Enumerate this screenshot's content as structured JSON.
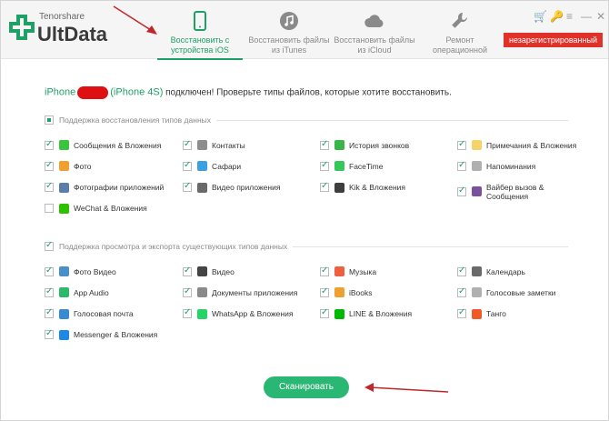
{
  "brand": {
    "small": "Tenorshare",
    "big": "UltData"
  },
  "tabs": [
    {
      "label1": "Восстановить с",
      "label2": "устройства iOS",
      "icon": "phone-icon",
      "active": true
    },
    {
      "label1": "Восстановить файлы",
      "label2": "из iTunes",
      "icon": "music-icon",
      "active": false
    },
    {
      "label1": "Восстановить файлы",
      "label2": "из iCloud",
      "icon": "cloud-icon",
      "active": false
    },
    {
      "label1": "Ремонт",
      "label2": "операционной",
      "icon": "wrench-icon",
      "active": false
    }
  ],
  "window_controls": {
    "cart": "🛒",
    "key": "🔑",
    "menu": "≡",
    "minimize": "—",
    "close": "✕"
  },
  "register_badge": "незарегистрированный",
  "device": {
    "name": "iPhone",
    "model": "(iPhone 4S)",
    "message": " подключен! Проверьте типы файлов, которые хотите восстановить."
  },
  "section1": {
    "title": "Поддержка восстановления типов данных",
    "items": [
      {
        "label": "Сообщения & Вложения",
        "checked": true,
        "icon": "messages-icon",
        "color": "#3cc43c"
      },
      {
        "label": "Контакты",
        "checked": true,
        "icon": "contacts-icon",
        "color": "#8d8d8d"
      },
      {
        "label": "История звонков",
        "checked": true,
        "icon": "phone-call-icon",
        "color": "#39b54a"
      },
      {
        "label": "Примечания & Вложения",
        "checked": true,
        "icon": "notes-icon",
        "color": "#f5d36a"
      },
      {
        "label": "Фото",
        "checked": true,
        "icon": "photos-icon",
        "color": "#f0a030"
      },
      {
        "label": "Сафари",
        "checked": true,
        "icon": "safari-icon",
        "color": "#3aa0e0"
      },
      {
        "label": "FaceTime",
        "checked": true,
        "icon": "facetime-icon",
        "color": "#34c759"
      },
      {
        "label": "Напоминания",
        "checked": true,
        "icon": "reminders-icon",
        "color": "#b0b0b0"
      },
      {
        "label": "Фотографии приложений",
        "checked": true,
        "icon": "app-photos-icon",
        "color": "#5a7ea8"
      },
      {
        "label": "Видео приложения",
        "checked": true,
        "icon": "app-video-icon",
        "color": "#6a6a6a"
      },
      {
        "label": "Kik & Вложения",
        "checked": true,
        "icon": "kik-icon",
        "color": "#3e3e3e"
      },
      {
        "label": "Вайбер вызов &",
        "label2": "Сообщения",
        "checked": true,
        "icon": "viber-icon",
        "color": "#7b519d"
      },
      {
        "label": "WeChat & Вложения",
        "checked": false,
        "icon": "wechat-icon",
        "color": "#2dc100"
      }
    ]
  },
  "section2": {
    "title": "Поддержка просмотра и экспорта существующих типов данных",
    "items": [
      {
        "label": "Фото Видео",
        "checked": true,
        "icon": "photo-video-icon",
        "color": "#4a90c8"
      },
      {
        "label": "Видео",
        "checked": true,
        "icon": "video-icon",
        "color": "#444444"
      },
      {
        "label": "Музыка",
        "checked": true,
        "icon": "music-app-icon",
        "color": "#f06040"
      },
      {
        "label": "Календарь",
        "checked": true,
        "icon": "calendar-icon",
        "color": "#6a6a6a"
      },
      {
        "label": "App Audio",
        "checked": true,
        "icon": "app-audio-icon",
        "color": "#2db86a"
      },
      {
        "label": "Документы приложения",
        "checked": true,
        "icon": "app-docs-icon",
        "color": "#8a8a8a"
      },
      {
        "label": "iBooks",
        "checked": true,
        "icon": "ibooks-icon",
        "color": "#f0a030"
      },
      {
        "label": "Голосовые заметки",
        "checked": true,
        "icon": "voice-memo-icon",
        "color": "#b0b0b0"
      },
      {
        "label": "Голосовая почта",
        "checked": true,
        "icon": "voicemail-icon",
        "color": "#3a8ad0"
      },
      {
        "label": "WhatsApp & Вложения",
        "checked": true,
        "icon": "whatsapp-icon",
        "color": "#25d366"
      },
      {
        "label": "LINE & Вложения",
        "checked": true,
        "icon": "line-icon",
        "color": "#00b900"
      },
      {
        "label": "Танго",
        "checked": true,
        "icon": "tango-icon",
        "color": "#f05a28"
      },
      {
        "label": "Messenger & Вложения",
        "checked": true,
        "icon": "messenger-icon",
        "color": "#1e88e5"
      }
    ]
  },
  "scan_button": "Сканировать"
}
